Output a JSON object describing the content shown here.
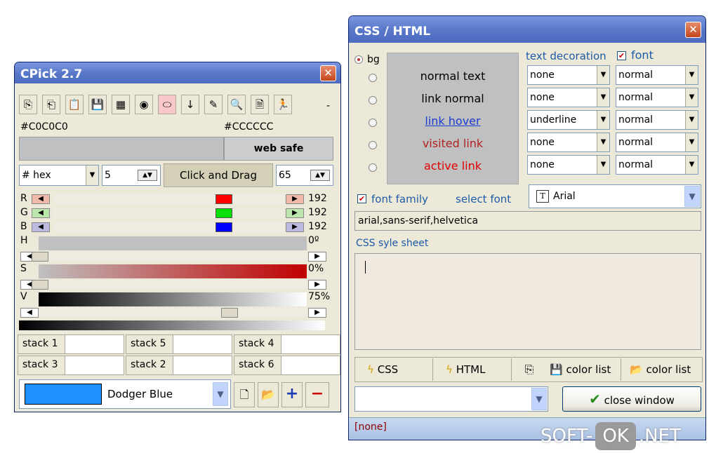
{
  "cpick": {
    "title": "CPick 2.7",
    "close": "✕",
    "toolbar": [
      "⎘",
      "⎗",
      "📋",
      "💾",
      "▦",
      "◉",
      "⬭",
      "↓",
      "✎",
      "🔍",
      "🗎",
      "🏃"
    ],
    "toolbar_names": [
      "copy-icon",
      "copy-color-icon",
      "paste-icon",
      "save-icon",
      "palette-icon",
      "color-wheel-icon",
      "eyedropper-icon",
      "down-arrow-icon",
      "pencil-icon",
      "zoom-icon",
      "document-icon",
      "exit-icon"
    ],
    "toolbar_more": "-",
    "color_left": "#C0C0C0",
    "color_right": "#CCCCCC",
    "web_safe": "web safe",
    "format": "# hex",
    "step": "5",
    "click_drag": "Click and Drag",
    "value": "65",
    "channels": [
      {
        "label": "R",
        "value": "192",
        "color": "#ff0000"
      },
      {
        "label": "G",
        "value": "192",
        "color": "#00e000"
      },
      {
        "label": "B",
        "value": "192",
        "color": "#0000ff"
      }
    ],
    "hsv": [
      {
        "label": "H",
        "value": "0º"
      },
      {
        "label": "S",
        "value": "0%"
      },
      {
        "label": "V",
        "value": "75%"
      }
    ],
    "stacks": [
      "stack 1",
      "stack 3",
      "stack 5",
      "stack 2",
      "stack 4",
      "stack 6"
    ],
    "color_name": "Dodger Blue",
    "swatch_color": "#1e90ff"
  },
  "css": {
    "title": "CSS / HTML",
    "close": "✕",
    "bg_label": "bg",
    "text_decoration_label": "text decoration",
    "font_label": "font",
    "samples": [
      "normal text",
      "link normal",
      "link hover",
      "visited link",
      "active link"
    ],
    "decorations": [
      "none",
      "none",
      "underline",
      "none",
      "none"
    ],
    "fonts": [
      "normal",
      "normal",
      "normal",
      "normal",
      "normal"
    ],
    "font_family_label": "font family",
    "select_font_label": "select font",
    "font_name": "Arial",
    "font_family_value": "arial,sans-serif,helvetica",
    "stylesheet_label": "CSS syle sheet",
    "btn_css": "CSS",
    "btn_html": "HTML",
    "btn_save_list": "color list",
    "btn_open_list": "color list",
    "close_window": "close window",
    "status": "[none]"
  },
  "watermark": {
    "left": "SOFT-",
    "mid": "OK",
    "right": ".NET"
  }
}
